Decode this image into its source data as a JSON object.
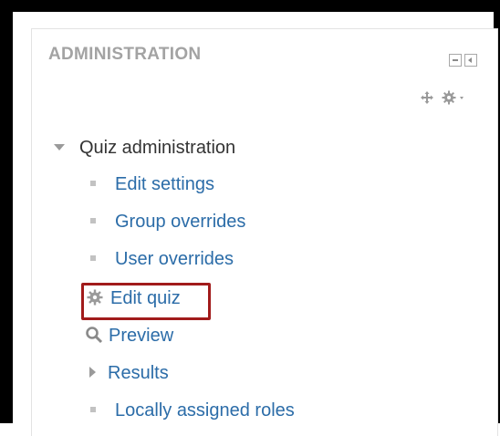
{
  "block": {
    "title": "ADMINISTRATION"
  },
  "tree": {
    "root_label": "Quiz administration",
    "items": [
      {
        "label": "Edit settings",
        "icon": "bullet"
      },
      {
        "label": "Group overrides",
        "icon": "bullet"
      },
      {
        "label": "User overrides",
        "icon": "bullet"
      },
      {
        "label": "Edit quiz",
        "icon": "gear-icon",
        "highlighted": true
      },
      {
        "label": "Preview",
        "icon": "magnifier-icon"
      },
      {
        "label": "Results",
        "icon": "caret-right",
        "expandable": true
      },
      {
        "label": "Locally assigned roles",
        "icon": "bullet"
      }
    ]
  },
  "colors": {
    "link": "#2b6ca8",
    "title": "#a3a3a3",
    "highlight_border": "#a11b1b",
    "bullet": "#c2c2c2"
  }
}
